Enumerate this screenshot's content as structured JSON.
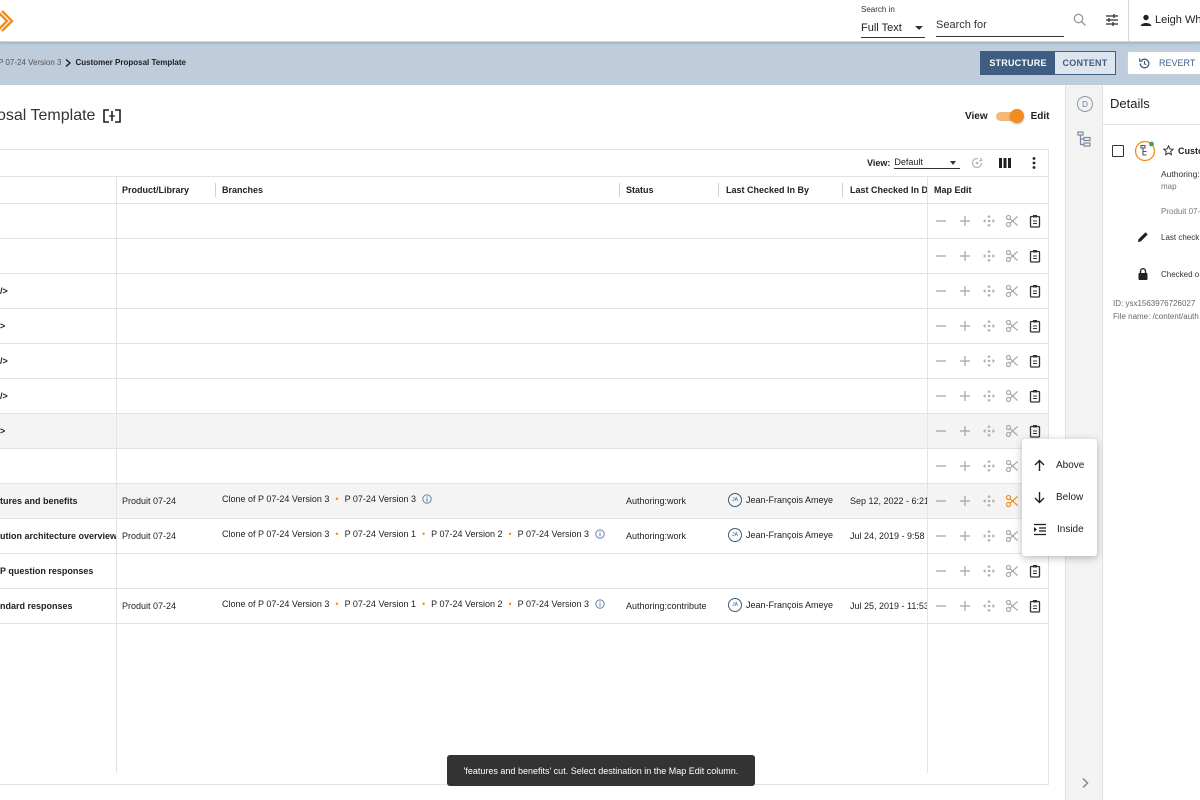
{
  "header": {
    "search_in_label": "Search in",
    "search_in_value": "Full Text",
    "search_placeholder": "Search for",
    "user_name": "Leigh Whi"
  },
  "breadcrumb": {
    "previous": "P 07-24 Version 3",
    "current": "Customer Proposal Template"
  },
  "mode_tabs": {
    "structure": "STRUCTURE",
    "content": "CONTENT"
  },
  "revert_label": "REVERT",
  "page": {
    "title": "osal Template",
    "view_label": "View",
    "edit_label": "Edit"
  },
  "grid": {
    "view_label": "View:",
    "view_value": "Default",
    "columns": [
      "Product/Library",
      "Branches",
      "Status",
      "Last Checked In By",
      "Last Checked In Da",
      "Map Edit"
    ],
    "rows": [
      {
        "name": "",
        "product": "",
        "branches": [],
        "status": "",
        "user_initials": "",
        "user": "",
        "date": ""
      },
      {
        "name": "",
        "product": "",
        "branches": [],
        "status": "",
        "user_initials": "",
        "user": "",
        "date": ""
      },
      {
        "name": "/>",
        "product": "",
        "branches": [],
        "status": "",
        "user_initials": "",
        "user": "",
        "date": ""
      },
      {
        "name": ">",
        "product": "",
        "branches": [],
        "status": "",
        "user_initials": "",
        "user": "",
        "date": ""
      },
      {
        "name": "/>",
        "product": "",
        "branches": [],
        "status": "",
        "user_initials": "",
        "user": "",
        "date": ""
      },
      {
        "name": "/>",
        "product": "",
        "branches": [],
        "status": "",
        "user_initials": "",
        "user": "",
        "date": ""
      },
      {
        "name": ">",
        "product": "",
        "branches": [],
        "status": "",
        "user_initials": "",
        "user": "",
        "date": ""
      },
      {
        "name": "",
        "product": "",
        "branches": [],
        "status": "",
        "user_initials": "",
        "user": "",
        "date": ""
      },
      {
        "name": "tures and benefits",
        "product": "Produit 07-24",
        "branches": [
          "Clone of P 07-24 Version 3",
          "P 07-24 Version 3"
        ],
        "status": "Authoring:work",
        "user_initials": "JA",
        "user": "Jean-François Ameye",
        "date": "Sep 12, 2022 - 6:21"
      },
      {
        "name": "ution architecture overview",
        "product": "Produit 07-24",
        "branches": [
          "Clone of P 07-24 Version 3",
          "P 07-24 Version 1",
          "P 07-24 Version 2",
          "P 07-24 Version 3"
        ],
        "status": "Authoring:work",
        "user_initials": "JA",
        "user": "Jean-François Ameye",
        "date": "Jul 24, 2019 - 9:58"
      },
      {
        "name": "P question responses",
        "product": "",
        "branches": [],
        "status": "",
        "user_initials": "",
        "user": "",
        "date": ""
      },
      {
        "name": "ndard responses",
        "product": "Produit 07-24",
        "branches": [
          "Clone of P 07-24 Version 3",
          "P 07-24 Version 1",
          "P 07-24 Version 2",
          "P 07-24 Version 3"
        ],
        "status": "Authoring:contribute",
        "user_initials": "JA",
        "user": "Jean-François Ameye",
        "date": "Jul 25, 2019 - 11:53"
      }
    ],
    "highlighted_rows": [
      6,
      8
    ],
    "cut_row_index": 8,
    "action_icons": [
      "minus-icon",
      "plus-icon",
      "move-icon",
      "scissors-icon",
      "clipboard-icon"
    ]
  },
  "paste_menu": {
    "above": "Above",
    "below": "Below",
    "inside": "Inside"
  },
  "snackbar": "'features and benefits' cut. Select destination in the Map Edit column.",
  "rail": {
    "d_label": "D"
  },
  "details": {
    "title": "Details",
    "item_title": "Custo",
    "status_line": "Authoring:",
    "type_line": "map",
    "product_line": "Produit 07-",
    "last_checked": "Last check",
    "checked_out": "Checked o",
    "id_line": "ID: ysx1563976726027",
    "file_line": "File name: /content/auth"
  },
  "colors": {
    "accent": "#f28c1e",
    "primary": "#3f5c82",
    "breadcrumb_bg": "#bfccdb",
    "snackbar_bg": "#333333"
  }
}
